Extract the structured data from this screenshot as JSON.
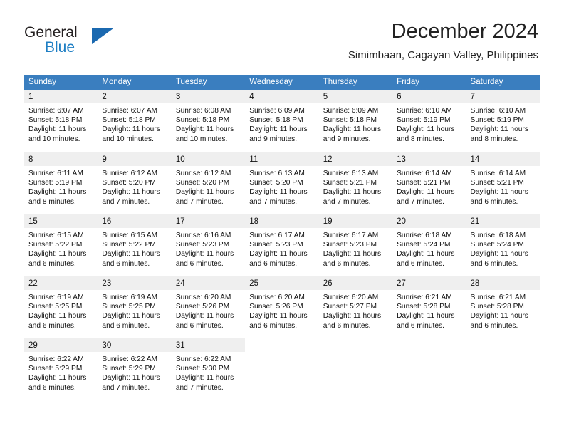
{
  "brand": {
    "word_one": "General",
    "word_two": "Blue",
    "triangle_icon": "triangle-logo-icon"
  },
  "header": {
    "month_title": "December 2024",
    "location": "Simimbaan, Cagayan Valley, Philippines"
  },
  "colors": {
    "header_blue": "#3a7ebf",
    "row_divider_blue": "#2e6da4",
    "daynum_band": "#efefef",
    "brand_blue": "#1f7fc4"
  },
  "calendar": {
    "weekday_headers": [
      "Sunday",
      "Monday",
      "Tuesday",
      "Wednesday",
      "Thursday",
      "Friday",
      "Saturday"
    ],
    "weeks": [
      [
        {
          "day": "1",
          "sunrise": "Sunrise: 6:07 AM",
          "sunset": "Sunset: 5:18 PM",
          "daylight_line1": "Daylight: 11 hours",
          "daylight_line2": "and 10 minutes."
        },
        {
          "day": "2",
          "sunrise": "Sunrise: 6:07 AM",
          "sunset": "Sunset: 5:18 PM",
          "daylight_line1": "Daylight: 11 hours",
          "daylight_line2": "and 10 minutes."
        },
        {
          "day": "3",
          "sunrise": "Sunrise: 6:08 AM",
          "sunset": "Sunset: 5:18 PM",
          "daylight_line1": "Daylight: 11 hours",
          "daylight_line2": "and 10 minutes."
        },
        {
          "day": "4",
          "sunrise": "Sunrise: 6:09 AM",
          "sunset": "Sunset: 5:18 PM",
          "daylight_line1": "Daylight: 11 hours",
          "daylight_line2": "and 9 minutes."
        },
        {
          "day": "5",
          "sunrise": "Sunrise: 6:09 AM",
          "sunset": "Sunset: 5:18 PM",
          "daylight_line1": "Daylight: 11 hours",
          "daylight_line2": "and 9 minutes."
        },
        {
          "day": "6",
          "sunrise": "Sunrise: 6:10 AM",
          "sunset": "Sunset: 5:19 PM",
          "daylight_line1": "Daylight: 11 hours",
          "daylight_line2": "and 8 minutes."
        },
        {
          "day": "7",
          "sunrise": "Sunrise: 6:10 AM",
          "sunset": "Sunset: 5:19 PM",
          "daylight_line1": "Daylight: 11 hours",
          "daylight_line2": "and 8 minutes."
        }
      ],
      [
        {
          "day": "8",
          "sunrise": "Sunrise: 6:11 AM",
          "sunset": "Sunset: 5:19 PM",
          "daylight_line1": "Daylight: 11 hours",
          "daylight_line2": "and 8 minutes."
        },
        {
          "day": "9",
          "sunrise": "Sunrise: 6:12 AM",
          "sunset": "Sunset: 5:20 PM",
          "daylight_line1": "Daylight: 11 hours",
          "daylight_line2": "and 7 minutes."
        },
        {
          "day": "10",
          "sunrise": "Sunrise: 6:12 AM",
          "sunset": "Sunset: 5:20 PM",
          "daylight_line1": "Daylight: 11 hours",
          "daylight_line2": "and 7 minutes."
        },
        {
          "day": "11",
          "sunrise": "Sunrise: 6:13 AM",
          "sunset": "Sunset: 5:20 PM",
          "daylight_line1": "Daylight: 11 hours",
          "daylight_line2": "and 7 minutes."
        },
        {
          "day": "12",
          "sunrise": "Sunrise: 6:13 AM",
          "sunset": "Sunset: 5:21 PM",
          "daylight_line1": "Daylight: 11 hours",
          "daylight_line2": "and 7 minutes."
        },
        {
          "day": "13",
          "sunrise": "Sunrise: 6:14 AM",
          "sunset": "Sunset: 5:21 PM",
          "daylight_line1": "Daylight: 11 hours",
          "daylight_line2": "and 7 minutes."
        },
        {
          "day": "14",
          "sunrise": "Sunrise: 6:14 AM",
          "sunset": "Sunset: 5:21 PM",
          "daylight_line1": "Daylight: 11 hours",
          "daylight_line2": "and 6 minutes."
        }
      ],
      [
        {
          "day": "15",
          "sunrise": "Sunrise: 6:15 AM",
          "sunset": "Sunset: 5:22 PM",
          "daylight_line1": "Daylight: 11 hours",
          "daylight_line2": "and 6 minutes."
        },
        {
          "day": "16",
          "sunrise": "Sunrise: 6:15 AM",
          "sunset": "Sunset: 5:22 PM",
          "daylight_line1": "Daylight: 11 hours",
          "daylight_line2": "and 6 minutes."
        },
        {
          "day": "17",
          "sunrise": "Sunrise: 6:16 AM",
          "sunset": "Sunset: 5:23 PM",
          "daylight_line1": "Daylight: 11 hours",
          "daylight_line2": "and 6 minutes."
        },
        {
          "day": "18",
          "sunrise": "Sunrise: 6:17 AM",
          "sunset": "Sunset: 5:23 PM",
          "daylight_line1": "Daylight: 11 hours",
          "daylight_line2": "and 6 minutes."
        },
        {
          "day": "19",
          "sunrise": "Sunrise: 6:17 AM",
          "sunset": "Sunset: 5:23 PM",
          "daylight_line1": "Daylight: 11 hours",
          "daylight_line2": "and 6 minutes."
        },
        {
          "day": "20",
          "sunrise": "Sunrise: 6:18 AM",
          "sunset": "Sunset: 5:24 PM",
          "daylight_line1": "Daylight: 11 hours",
          "daylight_line2": "and 6 minutes."
        },
        {
          "day": "21",
          "sunrise": "Sunrise: 6:18 AM",
          "sunset": "Sunset: 5:24 PM",
          "daylight_line1": "Daylight: 11 hours",
          "daylight_line2": "and 6 minutes."
        }
      ],
      [
        {
          "day": "22",
          "sunrise": "Sunrise: 6:19 AM",
          "sunset": "Sunset: 5:25 PM",
          "daylight_line1": "Daylight: 11 hours",
          "daylight_line2": "and 6 minutes."
        },
        {
          "day": "23",
          "sunrise": "Sunrise: 6:19 AM",
          "sunset": "Sunset: 5:25 PM",
          "daylight_line1": "Daylight: 11 hours",
          "daylight_line2": "and 6 minutes."
        },
        {
          "day": "24",
          "sunrise": "Sunrise: 6:20 AM",
          "sunset": "Sunset: 5:26 PM",
          "daylight_line1": "Daylight: 11 hours",
          "daylight_line2": "and 6 minutes."
        },
        {
          "day": "25",
          "sunrise": "Sunrise: 6:20 AM",
          "sunset": "Sunset: 5:26 PM",
          "daylight_line1": "Daylight: 11 hours",
          "daylight_line2": "and 6 minutes."
        },
        {
          "day": "26",
          "sunrise": "Sunrise: 6:20 AM",
          "sunset": "Sunset: 5:27 PM",
          "daylight_line1": "Daylight: 11 hours",
          "daylight_line2": "and 6 minutes."
        },
        {
          "day": "27",
          "sunrise": "Sunrise: 6:21 AM",
          "sunset": "Sunset: 5:28 PM",
          "daylight_line1": "Daylight: 11 hours",
          "daylight_line2": "and 6 minutes."
        },
        {
          "day": "28",
          "sunrise": "Sunrise: 6:21 AM",
          "sunset": "Sunset: 5:28 PM",
          "daylight_line1": "Daylight: 11 hours",
          "daylight_line2": "and 6 minutes."
        }
      ],
      [
        {
          "day": "29",
          "sunrise": "Sunrise: 6:22 AM",
          "sunset": "Sunset: 5:29 PM",
          "daylight_line1": "Daylight: 11 hours",
          "daylight_line2": "and 6 minutes."
        },
        {
          "day": "30",
          "sunrise": "Sunrise: 6:22 AM",
          "sunset": "Sunset: 5:29 PM",
          "daylight_line1": "Daylight: 11 hours",
          "daylight_line2": "and 7 minutes."
        },
        {
          "day": "31",
          "sunrise": "Sunrise: 6:22 AM",
          "sunset": "Sunset: 5:30 PM",
          "daylight_line1": "Daylight: 11 hours",
          "daylight_line2": "and 7 minutes."
        },
        {
          "day": "",
          "sunrise": "",
          "sunset": "",
          "daylight_line1": "",
          "daylight_line2": ""
        },
        {
          "day": "",
          "sunrise": "",
          "sunset": "",
          "daylight_line1": "",
          "daylight_line2": ""
        },
        {
          "day": "",
          "sunrise": "",
          "sunset": "",
          "daylight_line1": "",
          "daylight_line2": ""
        },
        {
          "day": "",
          "sunrise": "",
          "sunset": "",
          "daylight_line1": "",
          "daylight_line2": ""
        }
      ]
    ]
  }
}
